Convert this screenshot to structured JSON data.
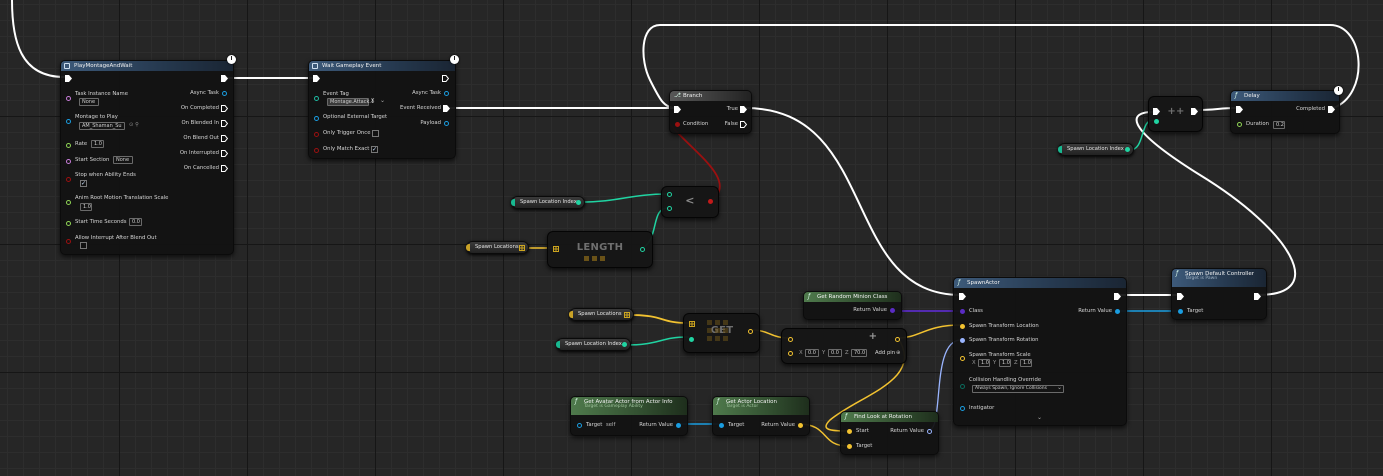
{
  "colors": {
    "exec": "#ffffff",
    "bool": "#9b1010",
    "int": "#20d4a2",
    "float": "#8fd455",
    "object": "#1a9de0",
    "vector": "#f2c230",
    "rotator": "#9ab5ff",
    "class": "#5a2cc4",
    "name": "#c77dd8",
    "struct": "#1fb9a2"
  },
  "play_montage": {
    "title": "PlayMontageAndWait",
    "inputs": {
      "task_instance_name": "Task Instance Name",
      "task_instance_value": "None",
      "montage_to_play": "Montage to Play",
      "montage_value": "AM_Shaman_Su",
      "rate": "Rate",
      "rate_value": "1.0",
      "start_section": "Start Section",
      "start_section_value": "None",
      "stop_when_ability_ends": "Stop when Ability Ends",
      "anim_root_motion": "Anim Root Motion Translation Scale",
      "anim_root_motion_value": "1.0",
      "start_time_seconds": "Start Time Seconds",
      "start_time_value": "0.0",
      "allow_interrupt": "Allow Interrupt After Blend Out"
    },
    "outputs": {
      "async_task": "Async Task",
      "on_completed": "On Completed",
      "on_blended_in": "On Blended In",
      "on_blend_out": "On Blend Out",
      "on_interrupted": "On Interrupted",
      "on_cancelled": "On Cancelled"
    }
  },
  "wait_event": {
    "title": "Wait Gameplay Event",
    "event_tag": "Event Tag",
    "event_tag_value": "Montage.Attack.1",
    "event_tag_x": "X",
    "optional_external_target": "Optional External Target",
    "only_trigger_once": "Only Trigger Once",
    "only_match_exact": "Only Match Exact",
    "async_task": "Async Task",
    "event_received": "Event Received",
    "payload": "Payload"
  },
  "branch": {
    "title": "Branch",
    "condition": "Condition",
    "true_label": "True",
    "false_label": "False"
  },
  "delay": {
    "title": "Delay",
    "completed": "Completed",
    "duration": "Duration",
    "duration_value": "0.2"
  },
  "increment": {
    "symbol": "++"
  },
  "compare": {
    "symbol": "<"
  },
  "length": {
    "label": "LENGTH"
  },
  "get": {
    "label": "GET"
  },
  "add": {
    "symbol": "+",
    "x_label": "X",
    "x_value": "0.0",
    "y_label": "Y",
    "y_value": "0.0",
    "z_label": "Z",
    "z_value": "70.0",
    "add_pin": "Add pin"
  },
  "vars": {
    "spawn_location_index": "Spawn Location Index",
    "spawn_locations": "Spawn Locations"
  },
  "random_minion": {
    "title": "Get Random Minion Class",
    "return_value": "Return Value"
  },
  "spawn_actor": {
    "title": "SpawnActor",
    "class": "Class",
    "spawn_transform_location": "Spawn Transform Location",
    "spawn_transform_rotation": "Spawn Transform Rotation",
    "spawn_transform_scale": "Spawn Transform Scale",
    "scale_x_label": "X",
    "scale_x": "1.0",
    "scale_y_label": "Y",
    "scale_y": "1.0",
    "scale_z_label": "Z",
    "scale_z": "1.0",
    "collision_override": "Collision Handling Override",
    "collision_value": "Always Spawn, Ignore Collisions",
    "instigator": "Instigator",
    "return_value": "Return Value"
  },
  "spawn_controller": {
    "title": "Spawn Default Controller",
    "subtitle": "Target is Pawn",
    "target": "Target"
  },
  "avatar_actor": {
    "title": "Get Avatar Actor from Actor Info",
    "subtitle": "Target is Gameplay Ability",
    "target": "Target",
    "target_value": "self",
    "return_value": "Return Value"
  },
  "actor_location": {
    "title": "Get Actor Location",
    "subtitle": "Target is Actor",
    "target": "Target",
    "return_value": "Return Value"
  },
  "look_at": {
    "title": "Find Look at Rotation",
    "start": "Start",
    "target": "Target",
    "return_value": "Return Value"
  }
}
